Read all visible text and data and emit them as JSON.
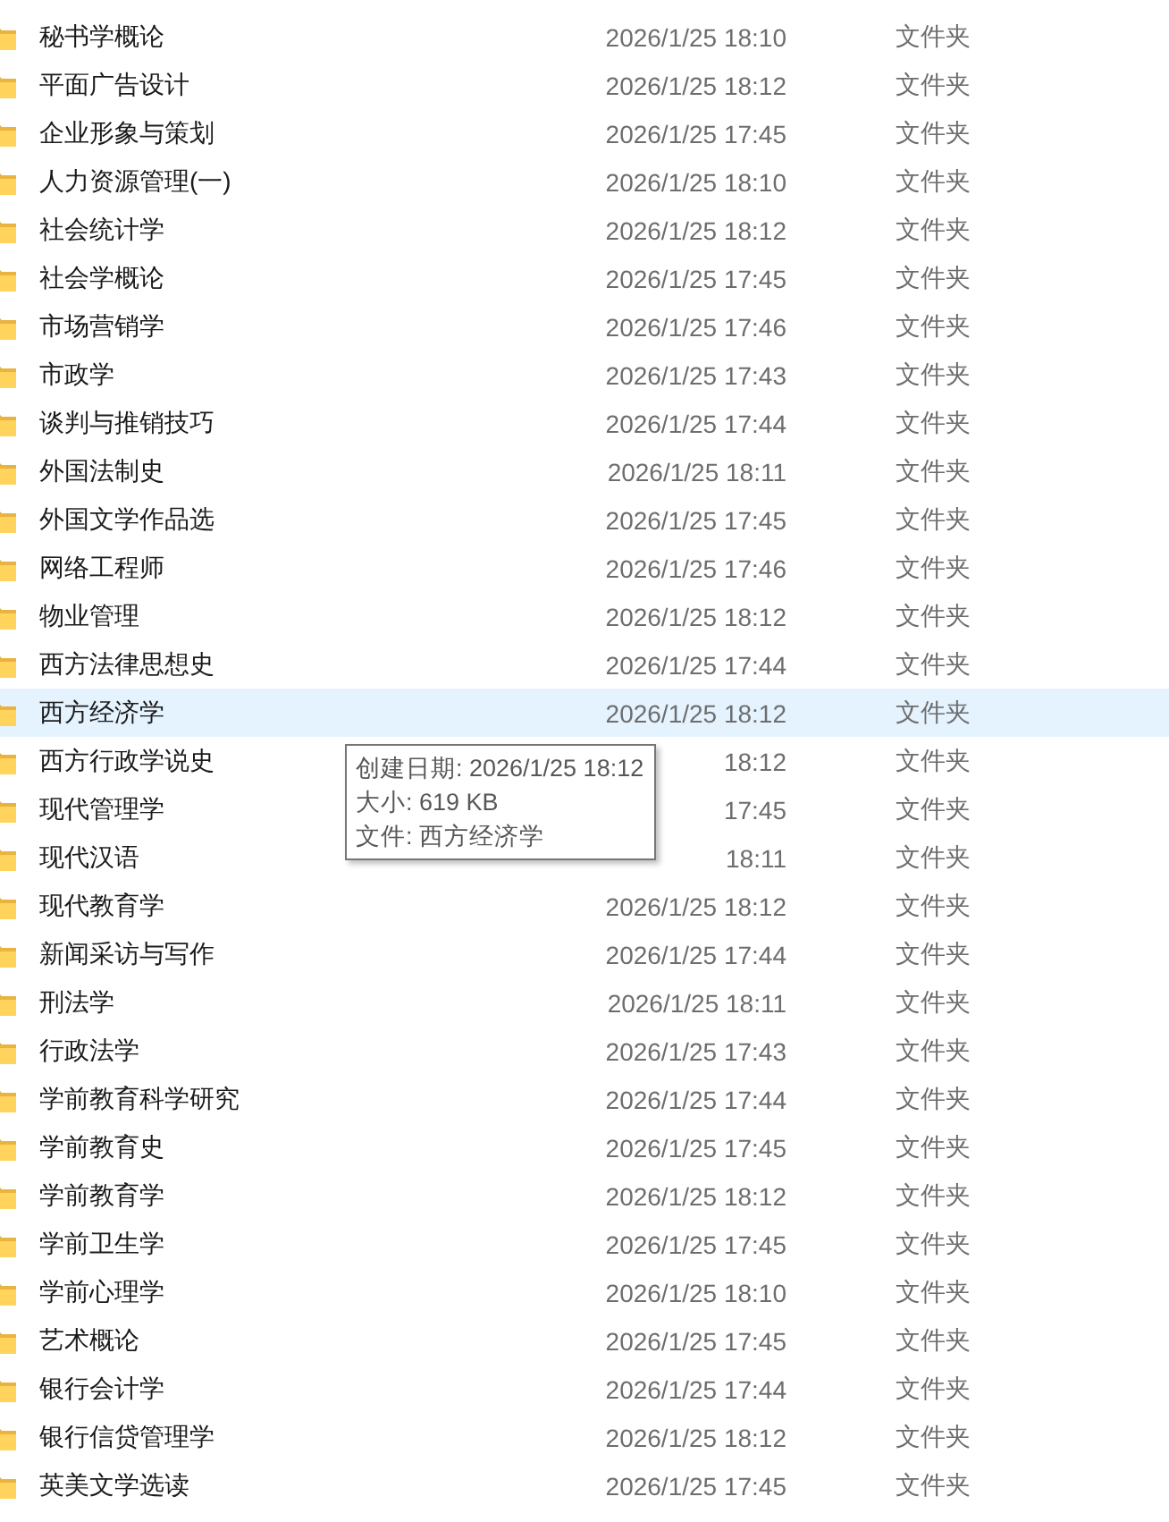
{
  "files": [
    {
      "name": "秘书学概论",
      "date": "2026/1/25 18:10",
      "type": "文件夹",
      "selected": false
    },
    {
      "name": "平面广告设计",
      "date": "2026/1/25 18:12",
      "type": "文件夹",
      "selected": false
    },
    {
      "name": "企业形象与策划",
      "date": "2026/1/25 17:45",
      "type": "文件夹",
      "selected": false
    },
    {
      "name": "人力资源管理(一)",
      "date": "2026/1/25 18:10",
      "type": "文件夹",
      "selected": false
    },
    {
      "name": "社会统计学",
      "date": "2026/1/25 18:12",
      "type": "文件夹",
      "selected": false
    },
    {
      "name": "社会学概论",
      "date": "2026/1/25 17:45",
      "type": "文件夹",
      "selected": false
    },
    {
      "name": "市场营销学",
      "date": "2026/1/25 17:46",
      "type": "文件夹",
      "selected": false
    },
    {
      "name": "市政学",
      "date": "2026/1/25 17:43",
      "type": "文件夹",
      "selected": false
    },
    {
      "name": "谈判与推销技巧",
      "date": "2026/1/25 17:44",
      "type": "文件夹",
      "selected": false
    },
    {
      "name": "外国法制史",
      "date": "2026/1/25 18:11",
      "type": "文件夹",
      "selected": false
    },
    {
      "name": "外国文学作品选",
      "date": "2026/1/25 17:45",
      "type": "文件夹",
      "selected": false
    },
    {
      "name": "网络工程师",
      "date": "2026/1/25 17:46",
      "type": "文件夹",
      "selected": false
    },
    {
      "name": "物业管理",
      "date": "2026/1/25 18:12",
      "type": "文件夹",
      "selected": false
    },
    {
      "name": "西方法律思想史",
      "date": "2026/1/25 17:44",
      "type": "文件夹",
      "selected": false
    },
    {
      "name": "西方经济学",
      "date": "2026/1/25 18:12",
      "type": "文件夹",
      "selected": true
    },
    {
      "name": "西方行政学说史",
      "date": "18:12",
      "type": "文件夹",
      "selected": false
    },
    {
      "name": "现代管理学",
      "date": "17:45",
      "type": "文件夹",
      "selected": false
    },
    {
      "name": "现代汉语",
      "date": "18:11",
      "type": "文件夹",
      "selected": false
    },
    {
      "name": "现代教育学",
      "date": "2026/1/25 18:12",
      "type": "文件夹",
      "selected": false
    },
    {
      "name": "新闻采访与写作",
      "date": "2026/1/25 17:44",
      "type": "文件夹",
      "selected": false
    },
    {
      "name": "刑法学",
      "date": "2026/1/25 18:11",
      "type": "文件夹",
      "selected": false
    },
    {
      "name": "行政法学",
      "date": "2026/1/25 17:43",
      "type": "文件夹",
      "selected": false
    },
    {
      "name": "学前教育科学研究",
      "date": "2026/1/25 17:44",
      "type": "文件夹",
      "selected": false
    },
    {
      "name": "学前教育史",
      "date": "2026/1/25 17:45",
      "type": "文件夹",
      "selected": false
    },
    {
      "name": "学前教育学",
      "date": "2026/1/25 18:12",
      "type": "文件夹",
      "selected": false
    },
    {
      "name": "学前卫生学",
      "date": "2026/1/25 17:45",
      "type": "文件夹",
      "selected": false
    },
    {
      "name": "学前心理学",
      "date": "2026/1/25 18:10",
      "type": "文件夹",
      "selected": false
    },
    {
      "name": "艺术概论",
      "date": "2026/1/25 17:45",
      "type": "文件夹",
      "selected": false
    },
    {
      "name": "银行会计学",
      "date": "2026/1/25 17:44",
      "type": "文件夹",
      "selected": false
    },
    {
      "name": "银行信贷管理学",
      "date": "2026/1/25 18:12",
      "type": "文件夹",
      "selected": false
    },
    {
      "name": "英美文学选读",
      "date": "2026/1/25 17:45",
      "type": "文件夹",
      "selected": false
    }
  ],
  "tooltip": {
    "lines": [
      "创建日期: 2026/1/25 18:12",
      "大小: 619 KB",
      "文件: 西方经济学"
    ]
  }
}
